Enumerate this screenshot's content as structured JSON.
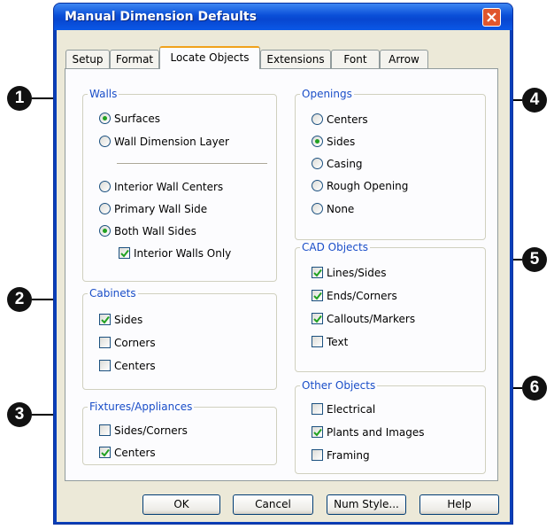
{
  "window": {
    "title": "Manual Dimension Defaults"
  },
  "tabs": [
    "Setup",
    "Format",
    "Locate Objects",
    "Extensions",
    "Font",
    "Arrow"
  ],
  "active_tab": "Locate Objects",
  "walls": {
    "label": "Walls",
    "surfaces": "Surfaces",
    "wall_dimension_layer": "Wall Dimension Layer",
    "interior_wall_centers": "Interior Wall Centers",
    "primary_wall_side": "Primary Wall Side",
    "both_wall_sides": "Both Wall Sides",
    "interior_walls_only": "Interior Walls Only"
  },
  "cabinets": {
    "label": "Cabinets",
    "sides": "Sides",
    "corners": "Corners",
    "centers": "Centers"
  },
  "fixtures": {
    "label": "Fixtures/Appliances",
    "sides_corners": "Sides/Corners",
    "centers": "Centers"
  },
  "openings": {
    "label": "Openings",
    "centers": "Centers",
    "sides": "Sides",
    "casing": "Casing",
    "rough_opening": "Rough Opening",
    "none": "None"
  },
  "cad": {
    "label": "CAD Objects",
    "lines_sides": "Lines/Sides",
    "ends_corners": "Ends/Corners",
    "callouts_markers": "Callouts/Markers",
    "text": "Text"
  },
  "other": {
    "label": "Other Objects",
    "electrical": "Electrical",
    "plants_images": "Plants and Images",
    "framing": "Framing"
  },
  "buttons": {
    "ok": "OK",
    "cancel": "Cancel",
    "num_style": "Num Style...",
    "help": "Help"
  },
  "callouts": [
    "1",
    "2",
    "3",
    "4",
    "5",
    "6"
  ],
  "colors": {
    "title_bar": "#0a4fd8",
    "group_label": "#1a4ec8",
    "close_button": "#e0562d",
    "dialog_bg": "#ece9d8"
  }
}
